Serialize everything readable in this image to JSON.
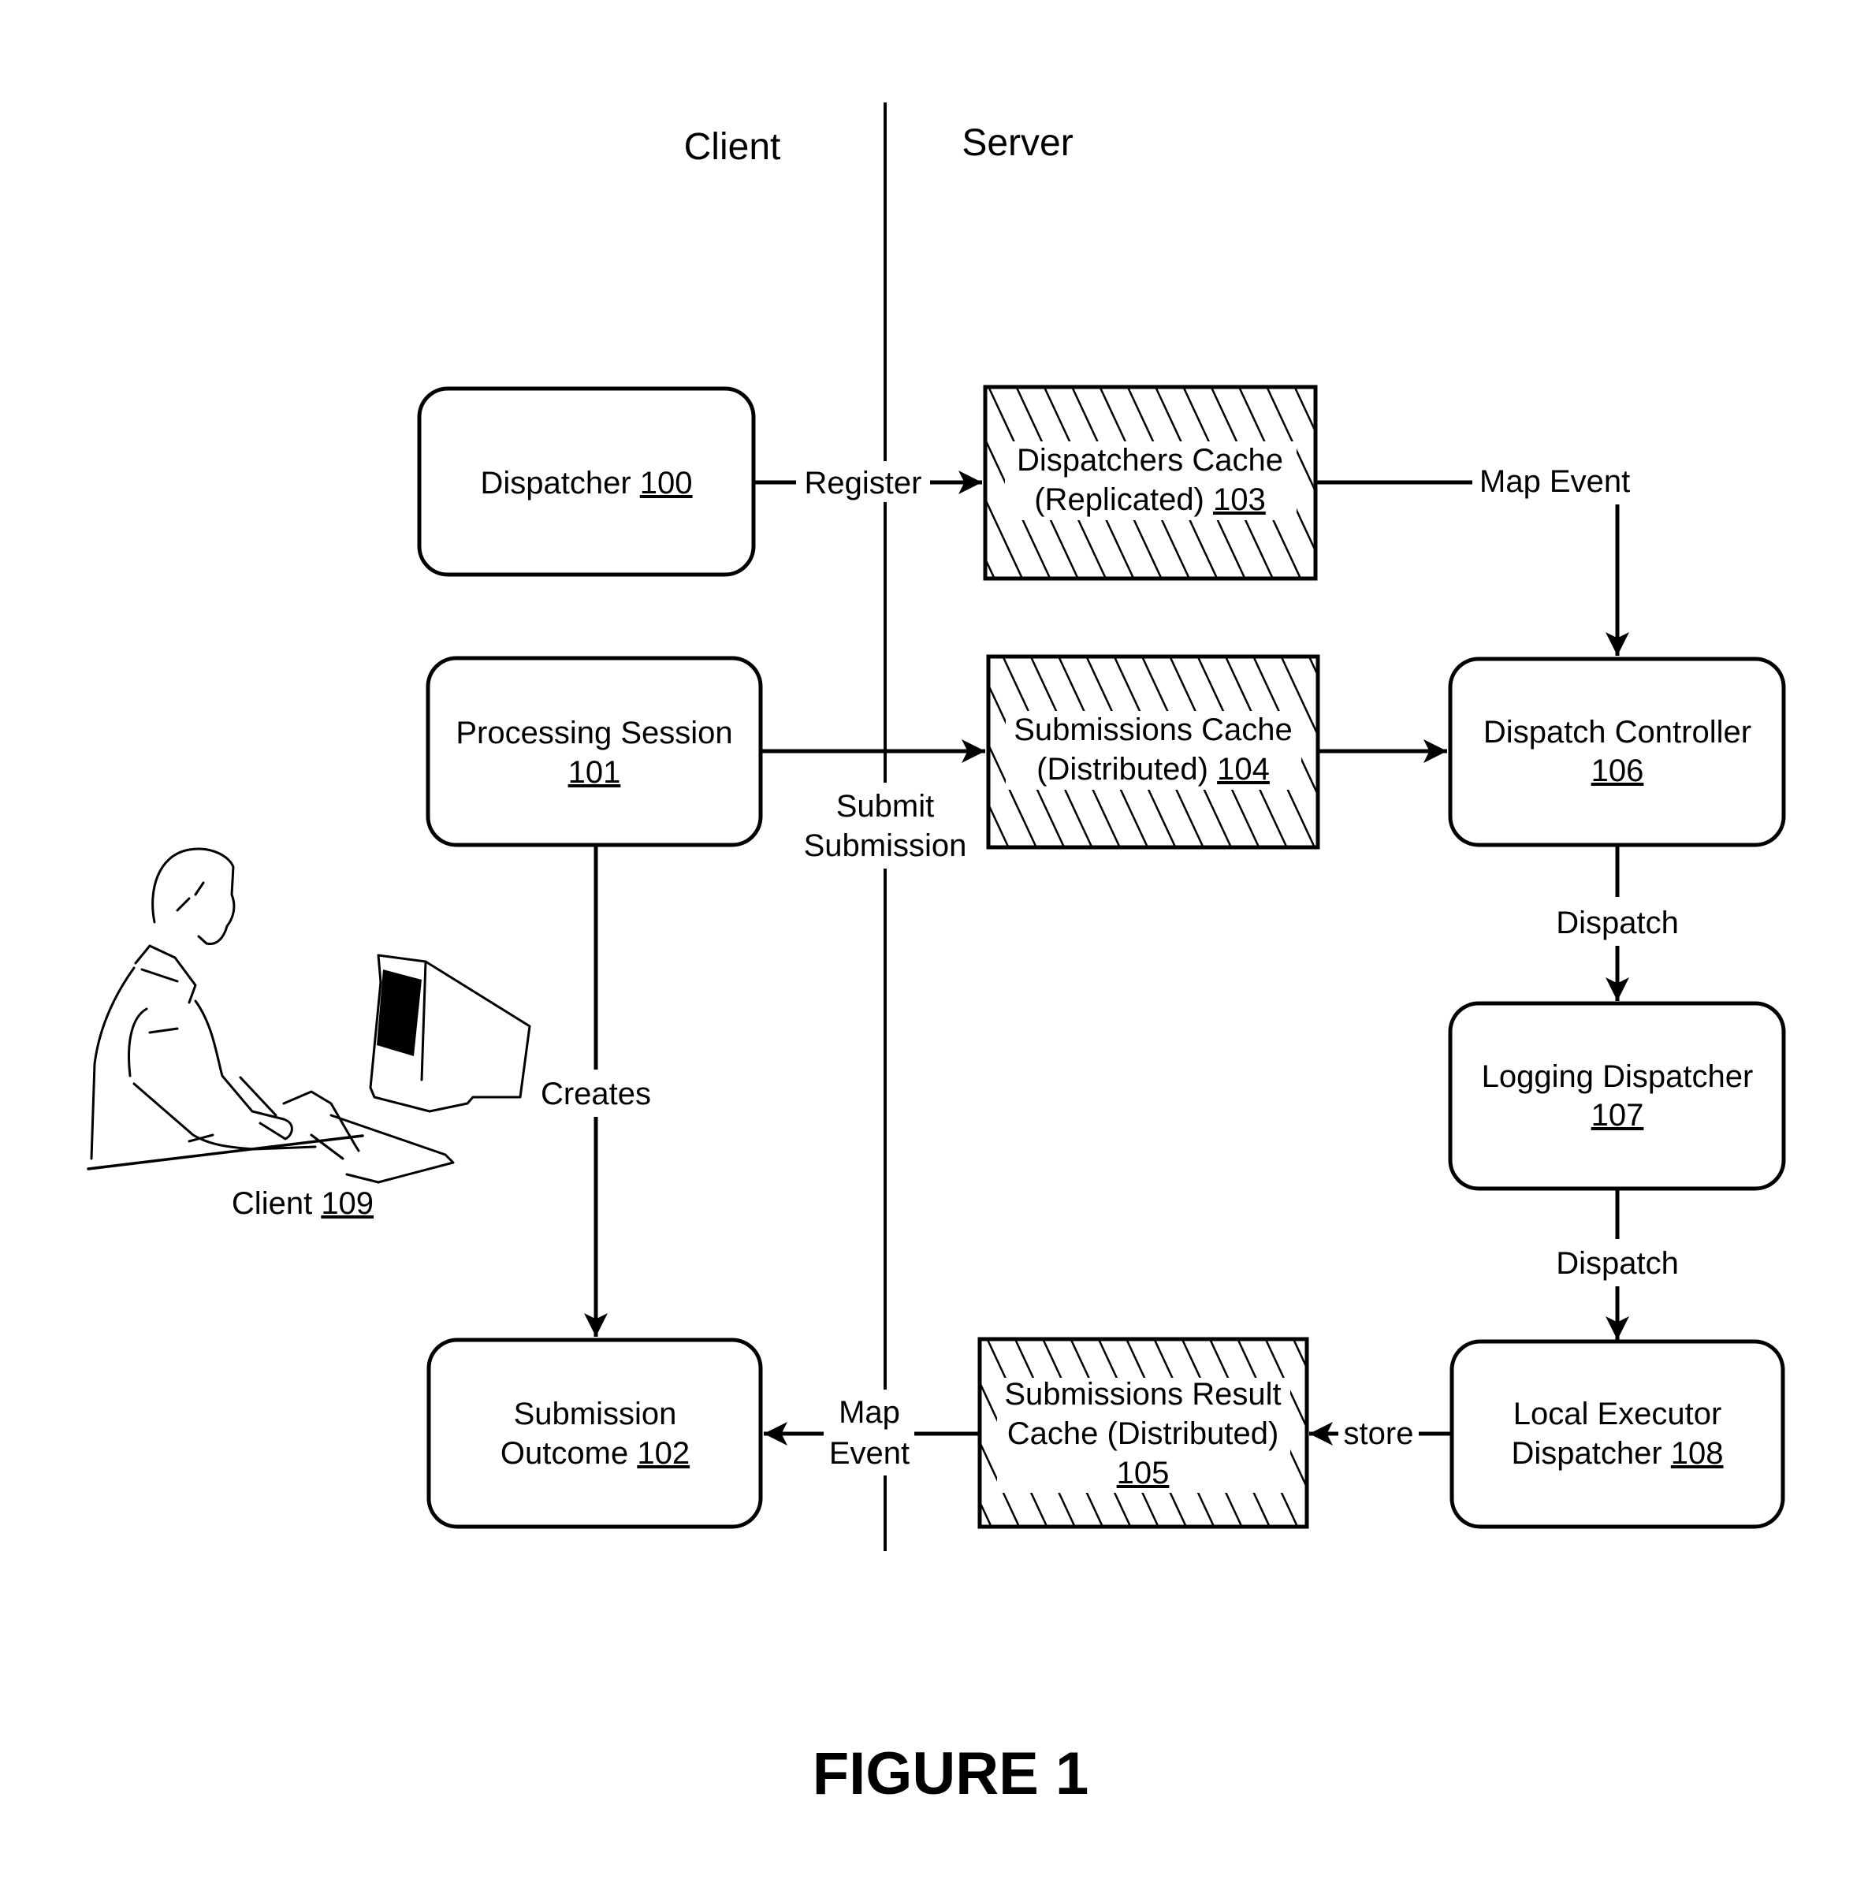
{
  "lanes": {
    "client": "Client",
    "server": "Server"
  },
  "nodes": {
    "dispatcher": {
      "lines": [
        "Dispatcher"
      ],
      "ref": "100",
      "ref_inline": true,
      "kind": "process"
    },
    "processing_session": {
      "lines": [
        "Processing Session"
      ],
      "ref": "101",
      "ref_inline": false,
      "kind": "process"
    },
    "submission_outcome": {
      "lines": [
        "Submission",
        "Outcome"
      ],
      "ref": "102",
      "ref_inline": true,
      "kind": "process"
    },
    "dispatchers_cache": {
      "lines": [
        "Dispatchers Cache",
        "(Replicated)"
      ],
      "ref": "103",
      "ref_inline": true,
      "kind": "cache"
    },
    "submissions_cache": {
      "lines": [
        "Submissions Cache",
        "(Distributed)"
      ],
      "ref": "104",
      "ref_inline": true,
      "kind": "cache"
    },
    "submissions_result_cache": {
      "lines": [
        "Submissions Result",
        "Cache (Distributed)"
      ],
      "ref": "105",
      "ref_inline": false,
      "kind": "cache"
    },
    "dispatch_controller": {
      "lines": [
        "Dispatch Controller"
      ],
      "ref": "106",
      "ref_inline": false,
      "kind": "process"
    },
    "logging_dispatcher": {
      "lines": [
        "Logging Dispatcher"
      ],
      "ref": "107",
      "ref_inline": false,
      "kind": "process"
    },
    "local_executor_dispatcher": {
      "lines": [
        "Local Executor",
        "Dispatcher"
      ],
      "ref": "108",
      "ref_inline": true,
      "kind": "process"
    }
  },
  "client_actor": {
    "label": "Client",
    "ref": "109",
    "icon": "person-at-computer-icon"
  },
  "edges": {
    "register": {
      "from": "dispatcher",
      "to": "dispatchers_cache",
      "label": [
        "Register"
      ]
    },
    "map_event_top": {
      "from": "dispatchers_cache",
      "to": "dispatch_controller",
      "label": [
        "Map Event"
      ]
    },
    "submit_submission": {
      "from": "processing_session",
      "to": "submissions_cache",
      "label": [
        "Submit",
        "Submission"
      ]
    },
    "to_controller": {
      "from": "submissions_cache",
      "to": "dispatch_controller",
      "label": []
    },
    "dispatch_1": {
      "from": "dispatch_controller",
      "to": "logging_dispatcher",
      "label": [
        "Dispatch"
      ]
    },
    "dispatch_2": {
      "from": "logging_dispatcher",
      "to": "local_executor_dispatcher",
      "label": [
        "Dispatch"
      ]
    },
    "store": {
      "from": "local_executor_dispatcher",
      "to": "submissions_result_cache",
      "label": [
        "store"
      ]
    },
    "map_event_bottom": {
      "from": "submissions_result_cache",
      "to": "submission_outcome",
      "label": [
        "Map",
        "Event"
      ]
    },
    "creates": {
      "from": "processing_session",
      "to": "submission_outcome",
      "label": [
        "Creates"
      ]
    }
  },
  "caption": "FIGURE 1"
}
